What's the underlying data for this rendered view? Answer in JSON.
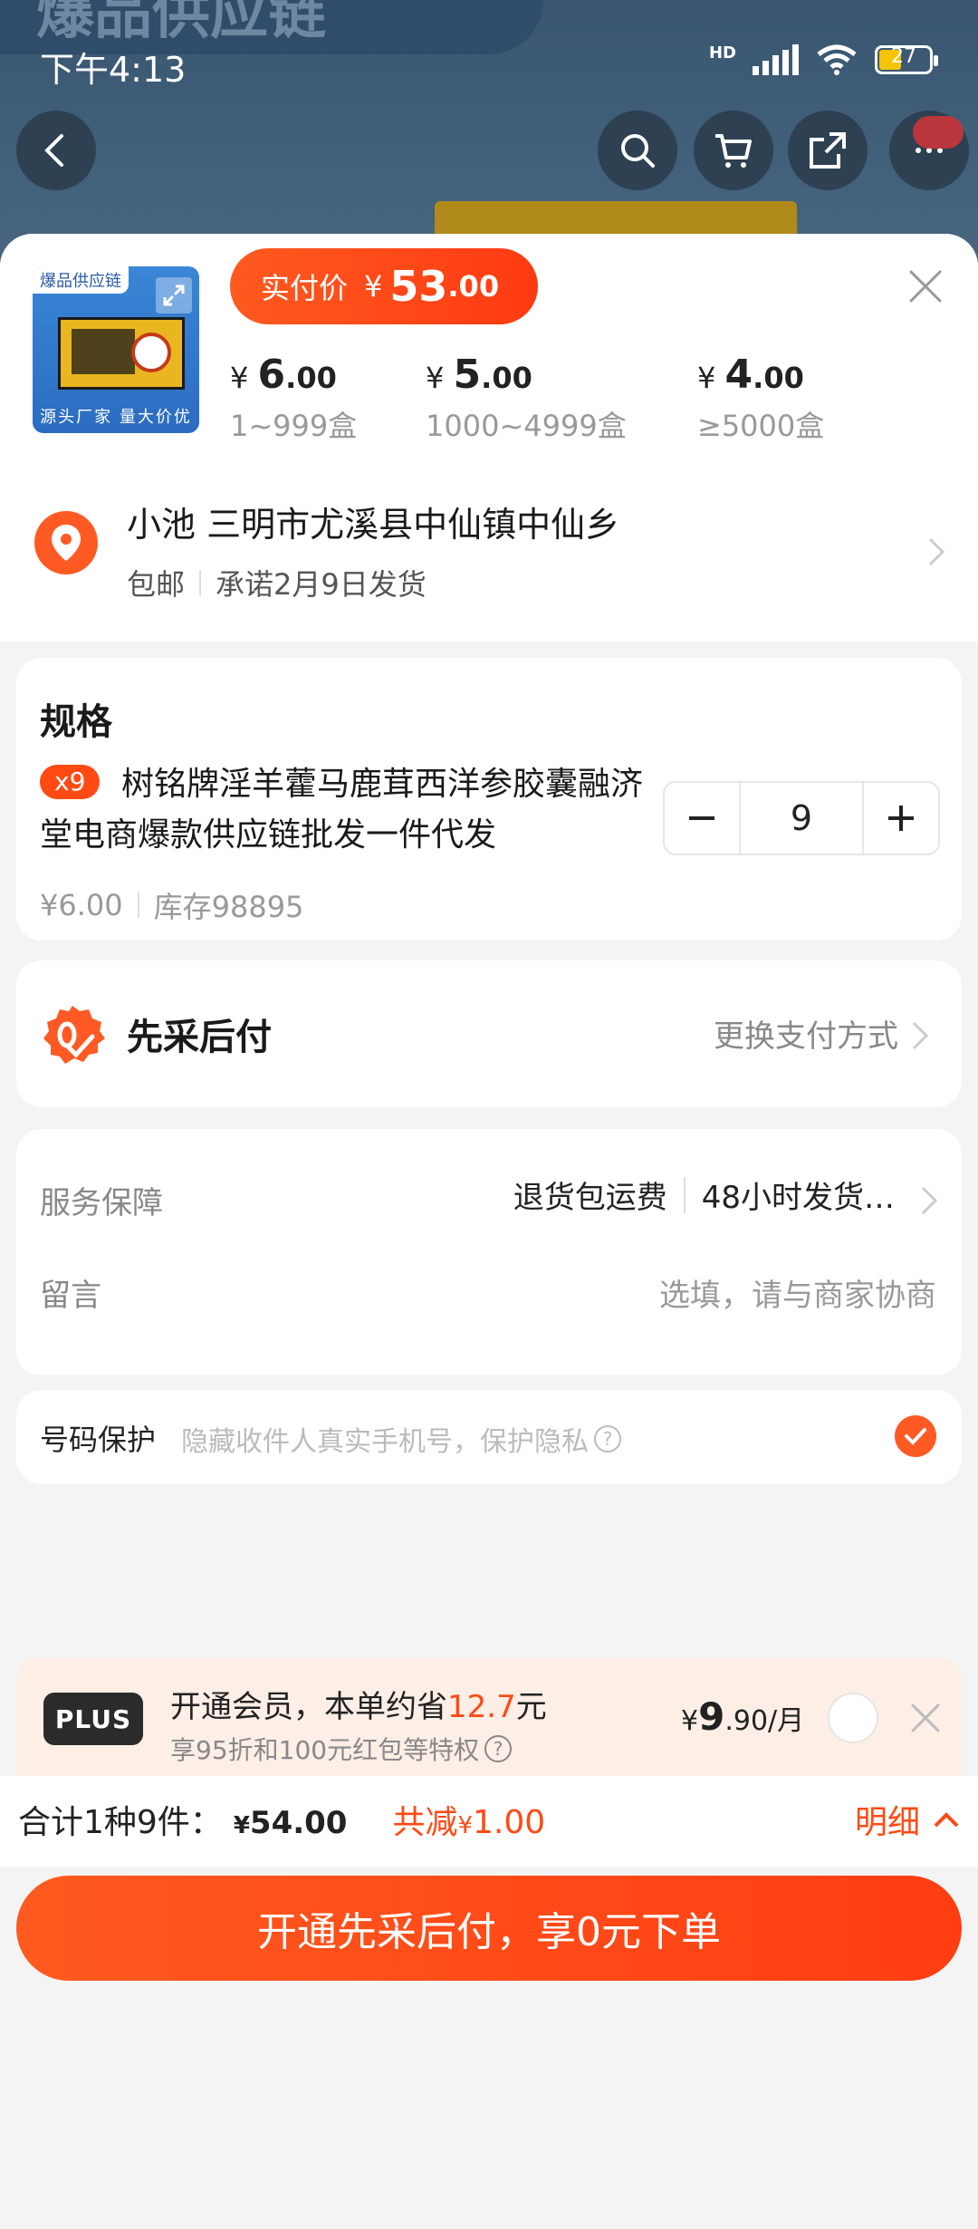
{
  "status": {
    "time": "下午4:13",
    "battery": "27",
    "network": "HD"
  },
  "background": {
    "banner_text": "爆品供应链"
  },
  "sheet": {
    "thumb": {
      "tag": "爆品供应链",
      "footer": "源头厂家  量大价优"
    },
    "pay_label": "实付价",
    "pay_currency": "¥",
    "pay_int": "53",
    "pay_dec": ".00",
    "tiers": [
      {
        "cur": "¥ ",
        "int": "6",
        "dec": ".00",
        "qty": "1~999盒"
      },
      {
        "cur": "¥ ",
        "int": "5",
        "dec": ".00",
        "qty": "1000~4999盒"
      },
      {
        "cur": "¥ ",
        "int": "4",
        "dec": ".00",
        "qty": "≥5000盒"
      }
    ]
  },
  "address": {
    "name_line": "小池 三明市尤溪县中仙镇中仙乡",
    "shipping": "包邮",
    "promise": "承诺2月9日发货"
  },
  "spec": {
    "title": "规格",
    "badge": "x9",
    "product_name": "树铭牌淫羊藿马鹿茸西洋参胶囊融济堂电商爆款供应链批发一件代发",
    "price": "¥6.00",
    "stock": "库存98895",
    "quantity": "9"
  },
  "payment": {
    "title": "先采后付",
    "change": "更换支付方式"
  },
  "service": {
    "label": "服务保障",
    "item1": "退货包运费",
    "item2": "48小时发货…",
    "message_label": "留言",
    "message_placeholder": "选填，请与商家协商"
  },
  "privacy": {
    "label": "号码保护",
    "desc": "隐藏收件人真实手机号，保护隐私"
  },
  "plus": {
    "logo": "PLUS",
    "title_prefix": "开通会员，本单约省",
    "title_amount": "12.7",
    "title_suffix": "元",
    "sub": "享95折和100元红包等特权",
    "price_cur": "¥",
    "price_int": "9",
    "price_rest": ".90/月"
  },
  "total": {
    "label": "合计1种9件：",
    "cur": "¥",
    "amount": "54.00",
    "discount_label": "共减",
    "discount_cur": "¥",
    "discount": "1.00",
    "detail": "明细"
  },
  "cta": {
    "label": "开通先采后付，享0元下单"
  },
  "colors": {
    "accent": "#ff4a14",
    "plus_bg": "#fdeee6"
  }
}
